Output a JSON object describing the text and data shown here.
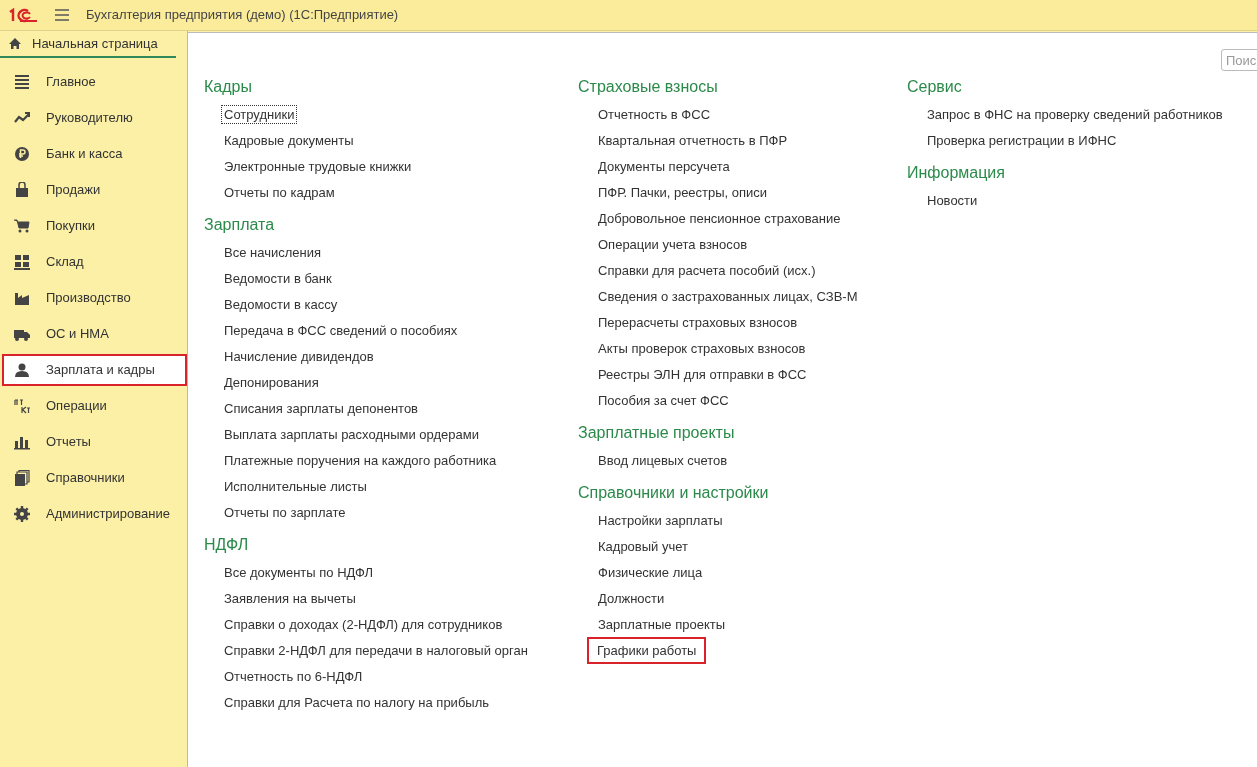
{
  "window": {
    "title": "Бухгалтерия предприятия (демо)  (1С:Предприятие)"
  },
  "home_tab": {
    "label": "Начальная страница",
    "selected": true
  },
  "sidebar": {
    "items": [
      {
        "label": "Главное",
        "selected": false,
        "highlighted": false
      },
      {
        "label": "Руководителю",
        "selected": false,
        "highlighted": false
      },
      {
        "label": "Банк и касса",
        "selected": false,
        "highlighted": false
      },
      {
        "label": "Продажи",
        "selected": false,
        "highlighted": false
      },
      {
        "label": "Покупки",
        "selected": false,
        "highlighted": false
      },
      {
        "label": "Склад",
        "selected": false,
        "highlighted": false
      },
      {
        "label": "Производство",
        "selected": false,
        "highlighted": false
      },
      {
        "label": "ОС и НМА",
        "selected": false,
        "highlighted": false
      },
      {
        "label": "Зарплата и кадры",
        "selected": true,
        "highlighted": true
      },
      {
        "label": "Операции",
        "selected": false,
        "highlighted": false
      },
      {
        "label": "Отчеты",
        "selected": false,
        "highlighted": false
      },
      {
        "label": "Справочники",
        "selected": false,
        "highlighted": false
      },
      {
        "label": "Администрирование",
        "selected": false,
        "highlighted": false
      }
    ]
  },
  "search": {
    "placeholder": "Поис"
  },
  "columns": [
    [
      {
        "title": "Кадры",
        "items": [
          {
            "label": "Сотрудники",
            "focused": true,
            "highlighted": false
          },
          {
            "label": "Кадровые документы",
            "focused": false,
            "highlighted": false
          },
          {
            "label": "Электронные трудовые книжки",
            "focused": false,
            "highlighted": false
          },
          {
            "label": "Отчеты по кадрам",
            "focused": false,
            "highlighted": false
          }
        ]
      },
      {
        "title": "Зарплата",
        "items": [
          {
            "label": "Все начисления",
            "focused": false,
            "highlighted": false
          },
          {
            "label": "Ведомости в банк",
            "focused": false,
            "highlighted": false
          },
          {
            "label": "Ведомости в кассу",
            "focused": false,
            "highlighted": false
          },
          {
            "label": "Передача в ФСС сведений о пособиях",
            "focused": false,
            "highlighted": false
          },
          {
            "label": "Начисление дивидендов",
            "focused": false,
            "highlighted": false
          },
          {
            "label": "Депонирования",
            "focused": false,
            "highlighted": false
          },
          {
            "label": "Списания зарплаты депонентов",
            "focused": false,
            "highlighted": false
          },
          {
            "label": "Выплата зарплаты расходными ордерами",
            "focused": false,
            "highlighted": false
          },
          {
            "label": "Платежные поручения на каждого работника",
            "focused": false,
            "highlighted": false
          },
          {
            "label": "Исполнительные листы",
            "focused": false,
            "highlighted": false
          },
          {
            "label": "Отчеты по зарплате",
            "focused": false,
            "highlighted": false
          }
        ]
      },
      {
        "title": "НДФЛ",
        "items": [
          {
            "label": "Все документы по НДФЛ",
            "focused": false,
            "highlighted": false
          },
          {
            "label": "Заявления на вычеты",
            "focused": false,
            "highlighted": false
          },
          {
            "label": "Справки о доходах (2-НДФЛ) для сотрудников",
            "focused": false,
            "highlighted": false
          },
          {
            "label": "Справки 2-НДФЛ для передачи в налоговый орган",
            "focused": false,
            "highlighted": false
          },
          {
            "label": "Отчетность по 6-НДФЛ",
            "focused": false,
            "highlighted": false
          },
          {
            "label": "Справки для Расчета по налогу на прибыль",
            "focused": false,
            "highlighted": false
          }
        ]
      }
    ],
    [
      {
        "title": "Страховые взносы",
        "items": [
          {
            "label": "Отчетность в ФСС",
            "focused": false,
            "highlighted": false
          },
          {
            "label": "Квартальная отчетность в ПФР",
            "focused": false,
            "highlighted": false
          },
          {
            "label": "Документы персучета",
            "focused": false,
            "highlighted": false
          },
          {
            "label": "ПФР. Пачки, реестры, описи",
            "focused": false,
            "highlighted": false
          },
          {
            "label": "Добровольное пенсионное страхование",
            "focused": false,
            "highlighted": false
          },
          {
            "label": "Операции учета взносов",
            "focused": false,
            "highlighted": false
          },
          {
            "label": "Справки для расчета пособий (исх.)",
            "focused": false,
            "highlighted": false
          },
          {
            "label": "Сведения о застрахованных лицах, СЗВ-М",
            "focused": false,
            "highlighted": false
          },
          {
            "label": "Перерасчеты страховых взносов",
            "focused": false,
            "highlighted": false
          },
          {
            "label": "Акты проверок страховых взносов",
            "focused": false,
            "highlighted": false
          },
          {
            "label": "Реестры ЭЛН для отправки в ФСС",
            "focused": false,
            "highlighted": false
          },
          {
            "label": "Пособия за счет ФСС",
            "focused": false,
            "highlighted": false
          }
        ]
      },
      {
        "title": "Зарплатные проекты",
        "items": [
          {
            "label": "Ввод лицевых счетов",
            "focused": false,
            "highlighted": false
          }
        ]
      },
      {
        "title": "Справочники и настройки",
        "items": [
          {
            "label": "Настройки зарплаты",
            "focused": false,
            "highlighted": false
          },
          {
            "label": "Кадровый учет",
            "focused": false,
            "highlighted": false
          },
          {
            "label": "Физические лица",
            "focused": false,
            "highlighted": false
          },
          {
            "label": "Должности",
            "focused": false,
            "highlighted": false
          },
          {
            "label": "Зарплатные проекты",
            "focused": false,
            "highlighted": false
          },
          {
            "label": "Графики работы",
            "focused": false,
            "highlighted": true
          }
        ]
      }
    ],
    [
      {
        "title": "Сервис",
        "items": [
          {
            "label": "Запрос в ФНС на проверку сведений работников",
            "focused": false,
            "highlighted": false
          },
          {
            "label": "Проверка регистрации в ИФНС",
            "focused": false,
            "highlighted": false
          }
        ]
      },
      {
        "title": "Информация",
        "items": [
          {
            "label": "Новости",
            "focused": false,
            "highlighted": false
          }
        ]
      }
    ]
  ]
}
